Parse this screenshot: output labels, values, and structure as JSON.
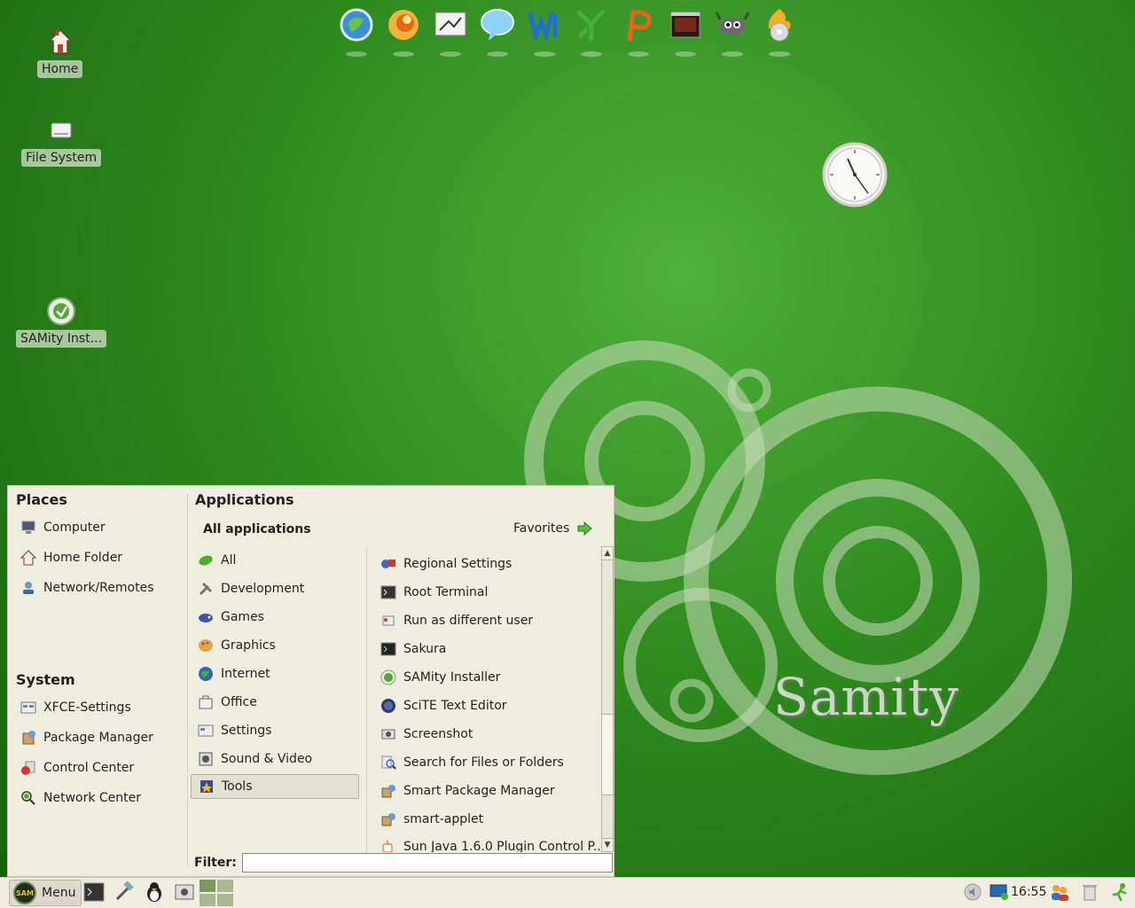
{
  "desktop": {
    "icons": [
      {
        "label": "Home",
        "icon": "home-icon"
      },
      {
        "label": "File System",
        "icon": "drive-icon"
      },
      {
        "label": "SAMity Inst...",
        "icon": "installer-icon"
      }
    ],
    "brand_text": "Samity"
  },
  "dock": {
    "items": [
      {
        "icon": "browser-globe-icon",
        "color": "#3a8fd6"
      },
      {
        "icon": "firefox-icon",
        "color": "#e88a1a"
      },
      {
        "icon": "presentation-icon",
        "color": "#d8d8d8"
      },
      {
        "icon": "chat-bubble-icon",
        "color": "#6ab8ee"
      },
      {
        "icon": "word-processor-icon",
        "color": "#1f6fd1"
      },
      {
        "icon": "spreadsheet-icon",
        "color": "#3fb23a"
      },
      {
        "icon": "presenter-icon",
        "color": "#e8651a"
      },
      {
        "icon": "video-player-icon",
        "color": "#7a2a1a"
      },
      {
        "icon": "gimp-icon",
        "color": "#555555"
      },
      {
        "icon": "cd-burner-icon",
        "color": "#f0b020"
      }
    ]
  },
  "menu": {
    "places_title": "Places",
    "places": [
      {
        "label": "Computer",
        "icon": "computer-icon"
      },
      {
        "label": "Home Folder",
        "icon": "home-folder-icon"
      },
      {
        "label": "Network/Remotes",
        "icon": "network-icon"
      }
    ],
    "system_title": "System",
    "system": [
      {
        "label": "XFCE-Settings",
        "icon": "settings-panel-icon"
      },
      {
        "label": "Package Manager",
        "icon": "package-icon"
      },
      {
        "label": "Control Center",
        "icon": "control-center-icon"
      },
      {
        "label": "Network Center",
        "icon": "network-center-icon"
      }
    ],
    "applications_title": "Applications",
    "all_applications": "All applications",
    "favorites": "Favorites",
    "categories": [
      {
        "label": "All",
        "icon": "leaf-icon"
      },
      {
        "label": "Development",
        "icon": "tools-icon"
      },
      {
        "label": "Games",
        "icon": "gamepad-icon"
      },
      {
        "label": "Graphics",
        "icon": "palette-icon"
      },
      {
        "label": "Internet",
        "icon": "globe-icon"
      },
      {
        "label": "Office",
        "icon": "office-icon"
      },
      {
        "label": "Settings",
        "icon": "settings-icon"
      },
      {
        "label": "Sound & Video",
        "icon": "media-icon"
      },
      {
        "label": "Tools",
        "icon": "toolbox-icon"
      }
    ],
    "selected_category": "Tools",
    "apps": [
      {
        "label": "Regional Settings",
        "icon": "regional-icon"
      },
      {
        "label": "Root Terminal",
        "icon": "terminal-icon"
      },
      {
        "label": "Run as different user",
        "icon": "run-as-icon"
      },
      {
        "label": "Sakura",
        "icon": "terminal-icon"
      },
      {
        "label": "SAMity Installer",
        "icon": "installer-icon"
      },
      {
        "label": "SciTE Text Editor",
        "icon": "editor-icon"
      },
      {
        "label": "Screenshot",
        "icon": "screenshot-icon"
      },
      {
        "label": "Search for Files or Folders",
        "icon": "search-icon"
      },
      {
        "label": "Smart Package Manager",
        "icon": "package-icon"
      },
      {
        "label": "smart-applet",
        "icon": "package-icon"
      },
      {
        "label": "Sun Java 1.6.0 Plugin Control P...",
        "icon": "java-icon"
      }
    ],
    "filter_label": "Filter:",
    "filter_value": ""
  },
  "taskbar": {
    "menu_label": "Menu",
    "menu_logo_text": "SAM",
    "clock": "16:55"
  }
}
